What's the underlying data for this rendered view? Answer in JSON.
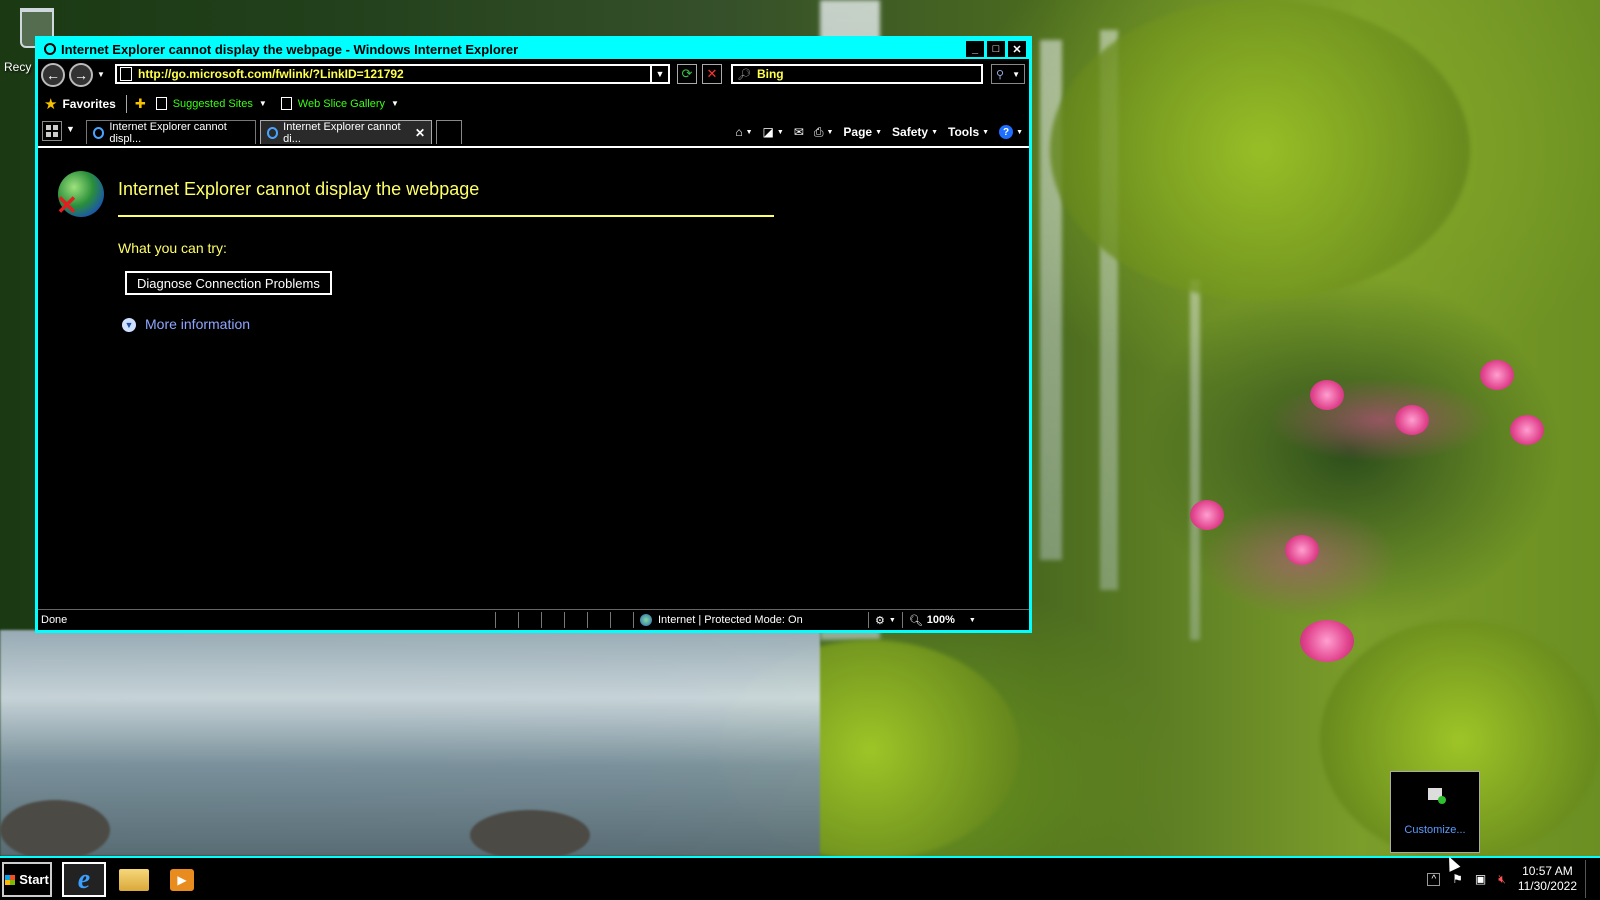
{
  "desktop": {
    "recycle_label": "Recy"
  },
  "window": {
    "title": "Internet Explorer cannot display the webpage - Windows Internet Explorer",
    "address_url": "http://go.microsoft.com/fwlink/?LinkID=121792",
    "search_placeholder": "Bing"
  },
  "favorites_bar": {
    "favorites_label": "Favorites",
    "links": [
      {
        "label": "Suggested Sites"
      },
      {
        "label": "Web Slice Gallery"
      }
    ]
  },
  "tabs": [
    {
      "label": "Internet Explorer cannot displ...",
      "active": false
    },
    {
      "label": "Internet Explorer cannot di...",
      "active": true
    }
  ],
  "command_bar": {
    "page": "Page",
    "safety": "Safety",
    "tools": "Tools",
    "help_glyph": "?"
  },
  "content": {
    "error_title": "Internet Explorer cannot display the webpage",
    "try_heading": "What you can try:",
    "diagnose_button": "Diagnose Connection Problems",
    "more_info_link": "More information"
  },
  "status_bar": {
    "status": "Done",
    "zone": "Internet | Protected Mode: On",
    "zoom": "100%"
  },
  "notification_popup": {
    "label": "Customize..."
  },
  "taskbar": {
    "start_label": "Start",
    "time": "10:57 AM",
    "date": "11/30/2022"
  },
  "colors": {
    "window_border": "#00ffff",
    "url_text": "#ffff4d",
    "link_green": "#39ff14",
    "heading_yellow": "#ffff66",
    "link_blue": "#8fa6ff"
  },
  "icons": [
    "recycle-bin-icon",
    "ie-icon",
    "back-icon",
    "forward-icon",
    "refresh-icon",
    "stop-icon",
    "search-icon",
    "star-icon",
    "home-icon",
    "rss-icon",
    "mail-icon",
    "print-icon",
    "help-icon",
    "globe-error-icon",
    "expand-icon",
    "flag-icon",
    "network-icon",
    "speaker-muted-icon",
    "folder-icon",
    "media-player-icon",
    "windows-logo-icon"
  ]
}
